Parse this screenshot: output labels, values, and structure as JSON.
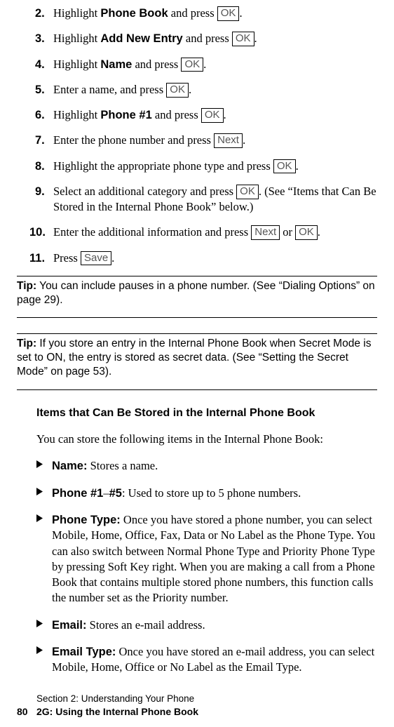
{
  "steps": [
    {
      "num": "2.",
      "pre": "Highlight ",
      "bold": "Phone Book",
      "post": " and press ",
      "key": "OK",
      "tail": "."
    },
    {
      "num": "3.",
      "pre": "Highlight ",
      "bold": "Add New Entry",
      "post": " and press ",
      "key": "OK",
      "tail": "."
    },
    {
      "num": "4.",
      "pre": "Highlight ",
      "bold": "Name",
      "post": " and press ",
      "key": "OK",
      "tail": "."
    },
    {
      "num": "5.",
      "pre": "Enter a name, and press ",
      "bold": "",
      "post": "",
      "key": "OK",
      "tail": "."
    },
    {
      "num": "6.",
      "pre": "Highlight ",
      "bold": "Phone #1",
      "post": " and press ",
      "key": "OK",
      "tail": "."
    },
    {
      "num": "7.",
      "pre": "Enter the phone number and press ",
      "bold": "",
      "post": "",
      "key": "Next",
      "tail": "."
    },
    {
      "num": "8.",
      "pre": "Highlight the appropriate phone type and press ",
      "bold": "",
      "post": "",
      "key": "OK",
      "tail": "."
    }
  ],
  "step9": {
    "num": "9.",
    "pre": "Select an additional category and press ",
    "key": "OK",
    "tail": ". (See “Items that Can Be Stored in the Internal Phone Book” below.)"
  },
  "step10": {
    "num": "10.",
    "pre": "Enter the additional information and press ",
    "key1": "Next",
    "mid": " or ",
    "key2": "OK",
    "tail": "."
  },
  "step11": {
    "num": "11.",
    "pre": "Press ",
    "key": "Save",
    "tail": "."
  },
  "tip1": {
    "label": "Tip:",
    "text": " You can include pauses in a phone number. (See “Dialing Options” on page 29)."
  },
  "tip2": {
    "label": "Tip:",
    "text": " If you store an entry in the Internal Phone Book when Secret Mode is set to ON, the entry is stored as secret data. (See “Setting the Secret Mode” on page 53)."
  },
  "section_heading": "Items that Can Be Stored in the Internal Phone Book",
  "intro": "You can store the following items in the Internal Phone Book:",
  "bullets": {
    "b1": {
      "label": "Name:",
      "text": " Stores a name."
    },
    "b2": {
      "label1": "Phone #1",
      "dash": "–",
      "label2": "#5",
      "text": ": Used to store up to 5 phone numbers."
    },
    "b3": {
      "label": "Phone Type:",
      "text": " Once you have stored a phone number, you can select Mobile, Home, Office, Fax, Data or No Label as the Phone Type. You can also switch between Normal Phone Type and Priority Phone Type by pressing Soft Key right. When you are making a call from a Phone Book that contains multiple stored phone numbers, this function calls the number set as the Priority number."
    },
    "b4": {
      "label": "Email:",
      "text": " Stores an e-mail address."
    },
    "b5": {
      "label": "Email Type:",
      "text": " Once you have stored an e-mail address, you can select Mobile, Home, Office or No Label as the Email Type."
    }
  },
  "footer": {
    "line1": "Section 2: Understanding Your Phone",
    "page": "80",
    "line2": "2G: Using the Internal Phone Book"
  }
}
